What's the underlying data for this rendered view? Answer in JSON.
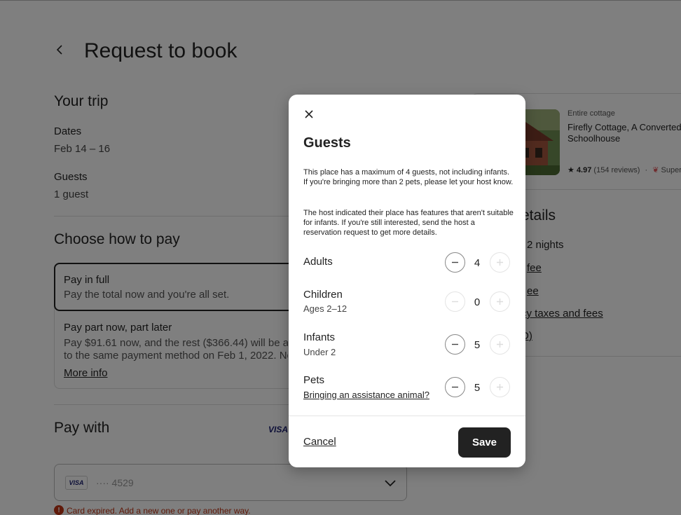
{
  "page": {
    "title": "Request to book",
    "trip": {
      "heading": "Your trip",
      "dates_label": "Dates",
      "dates_value": "Feb 14 – 16",
      "guests_label": "Guests",
      "guests_value": "1 guest"
    },
    "payment": {
      "heading": "Choose how to pay",
      "full_title": "Pay in full",
      "full_sub": "Pay the total now and you're all set.",
      "part_title": "Pay part now, part later",
      "part_sub_1": "Pay $91.61 now, and the rest ($366.44) will be auto",
      "part_sub_2": "to the same payment method on Feb 1, 2022. No",
      "more_info": "More info"
    },
    "pay_with": {
      "heading": "Pay with",
      "visa": "VISA",
      "card_brand": "VISA",
      "card_number": "···· 4529",
      "error": "Card expired. Add a new one or pay another way."
    }
  },
  "listing": {
    "type": "Entire cottage",
    "name": "Firefly Cottage, A Converted Schoolhouse",
    "rating": "4.97",
    "reviews": "(154 reviews)",
    "separator": "·",
    "superhost": "Super",
    "price_title": "etails",
    "price_lines": [
      "2 nights",
      "fee",
      "ee",
      "cy taxes and fees",
      "D)"
    ]
  },
  "modal": {
    "title": "Guests",
    "para1": "This place has a maximum of 4 guests, not including infants. If you're bringing more than 2 pets, please let your host know.",
    "para2": "The host indicated their place has features that aren't suitable for infants. If you're still interested, send the host a reservation request to get more details.",
    "rows": [
      {
        "label": "Adults",
        "sub": "",
        "count": "4"
      },
      {
        "label": "Children",
        "sub": "Ages 2–12",
        "count": "0"
      },
      {
        "label": "Infants",
        "sub": "Under 2",
        "count": "5"
      },
      {
        "label": "Pets",
        "link": "Bringing an assistance animal?",
        "count": "5"
      }
    ],
    "cancel": "Cancel",
    "save": "Save"
  }
}
